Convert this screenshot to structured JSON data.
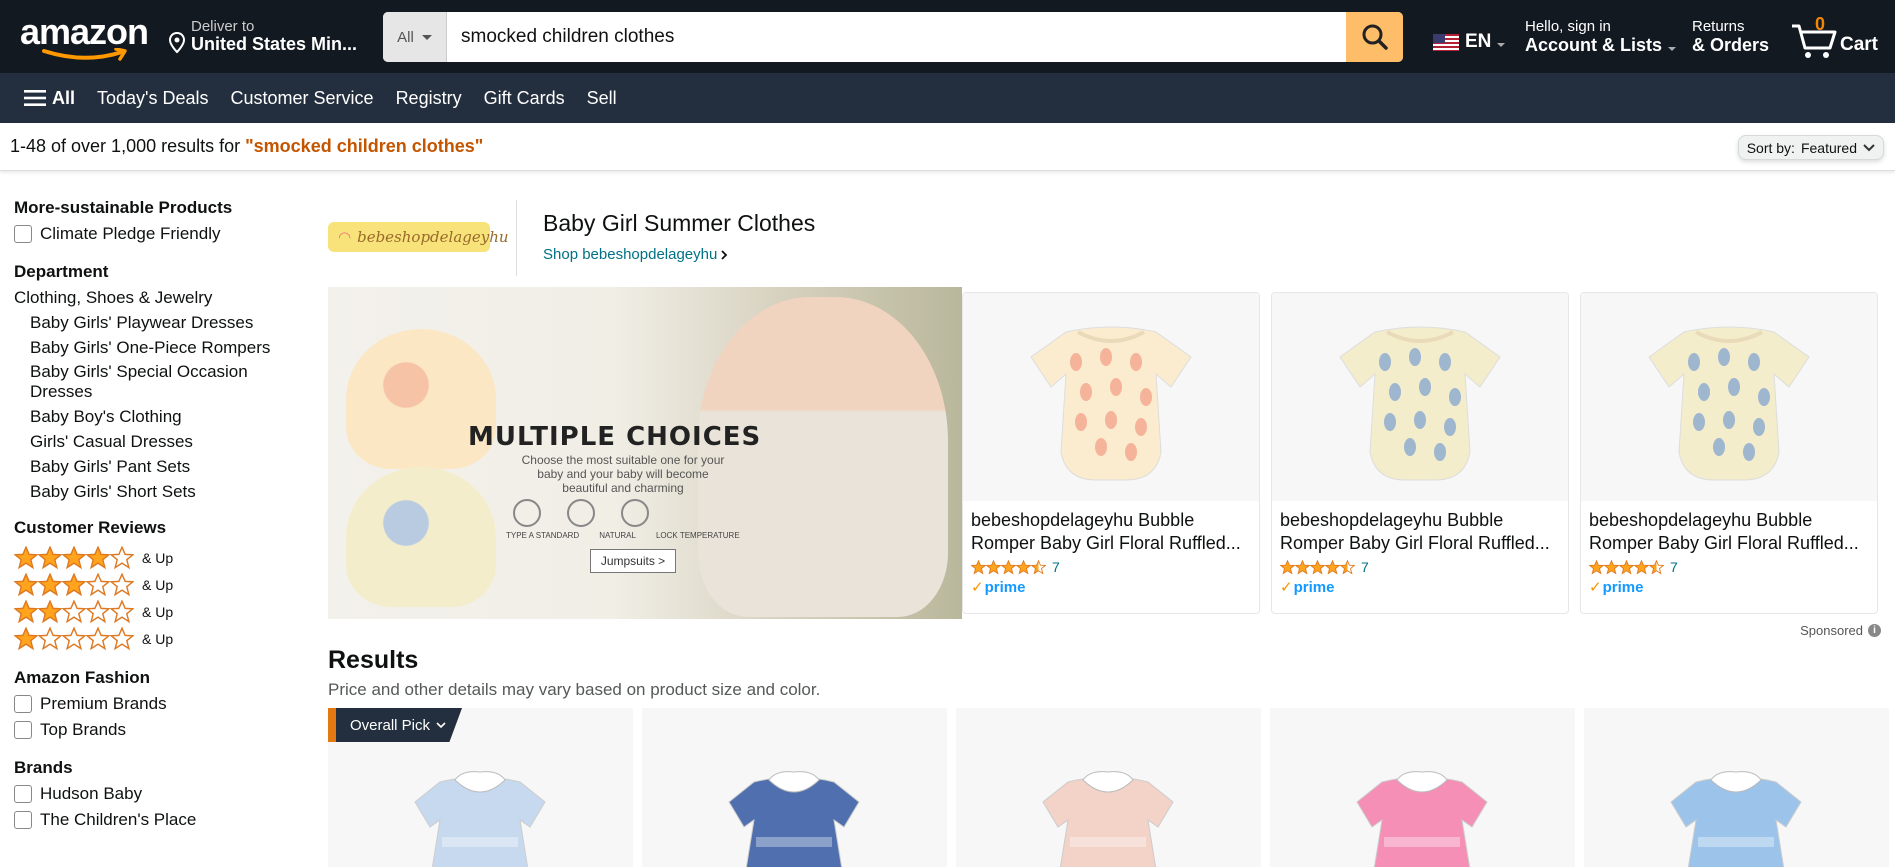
{
  "header": {
    "logo_text": "amazon",
    "deliver_to_label": "Deliver to",
    "deliver_to_location": "United States Min...",
    "search_category": "All",
    "search_query": "smocked children clothes",
    "language": "EN",
    "account_greeting": "Hello, sign in",
    "account_label": "Account & Lists",
    "returns_label": "Returns",
    "orders_label": "& Orders",
    "cart_count": "0",
    "cart_label": "Cart"
  },
  "subnav": {
    "all_label": "All",
    "items": [
      "Today's Deals",
      "Customer Service",
      "Registry",
      "Gift Cards",
      "Sell"
    ]
  },
  "results_bar": {
    "count_text": "1-48 of over 1,000 results for ",
    "query_text": "\"smocked children clothes\"",
    "sort_label": "Sort by:",
    "sort_value": "Featured"
  },
  "sidebar": {
    "sustainable_heading": "More-sustainable Products",
    "sustainable_option": "Climate Pledge Friendly",
    "department_heading": "Department",
    "department_top": "Clothing, Shoes & Jewelry",
    "department_items": [
      "Baby Girls' Playwear Dresses",
      "Baby Girls' One-Piece Rompers",
      "Baby Girls' Special Occasion Dresses",
      "Baby Boy's Clothing",
      "Girls' Casual Dresses",
      "Baby Girls' Pant Sets",
      "Baby Girls' Short Sets"
    ],
    "reviews_heading": "Customer Reviews",
    "review_rows": [
      {
        "stars": 4,
        "label": "& Up"
      },
      {
        "stars": 3,
        "label": "& Up"
      },
      {
        "stars": 2,
        "label": "& Up"
      },
      {
        "stars": 1,
        "label": "& Up"
      }
    ],
    "fashion_heading": "Amazon Fashion",
    "fashion_options": [
      "Premium Brands",
      "Top Brands"
    ],
    "brands_heading": "Brands",
    "brand_options": [
      "Hudson Baby",
      "The Children's Place"
    ]
  },
  "sponsored_brand": {
    "logo_text": "bebeshopdelageyhu",
    "title": "Baby Girl Summer Clothes",
    "shop_link": "Shop bebeshopdelageyhu",
    "banner_headline": "MULTIPLE CHOICES",
    "banner_subtext": "Choose the most suitable one for your baby and your baby will become beautiful and charming",
    "banner_icon_labels": [
      "TYPE A STANDARD",
      "NATURAL",
      "LOCK TEMPERATURE"
    ],
    "banner_button": "Jumpsuits >",
    "products": [
      {
        "title": "bebeshopdelageyhu Bubble Romper Baby Girl Floral Ruffled...",
        "rating": 4.5,
        "review_count": "7",
        "prime": "prime",
        "print_color": "#f5b39a",
        "fabric": "#fbeccf"
      },
      {
        "title": "bebeshopdelageyhu Bubble Romper Baby Girl Floral Ruffled...",
        "rating": 4.5,
        "review_count": "7",
        "prime": "prime",
        "print_color": "#9fb6cf",
        "fabric": "#f3edcb"
      },
      {
        "title": "bebeshopdelageyhu Bubble Romper Baby Girl Floral Ruffled...",
        "rating": 4.5,
        "review_count": "7",
        "prime": "prime",
        "print_color": "#9fb6cf",
        "fabric": "#f3edcb"
      }
    ],
    "sponsored_label": "Sponsored"
  },
  "results": {
    "heading": "Results",
    "subheading": "Price and other details may vary based on product size and color.",
    "badge": "Overall Pick",
    "products": [
      {
        "dress_color": "#c7d9ef"
      },
      {
        "dress_color": "#4f6fae"
      },
      {
        "dress_color": "#f3d2c8"
      },
      {
        "dress_color": "#f58fb6"
      },
      {
        "dress_color": "#9cc3ea"
      }
    ]
  },
  "colors": {
    "nav_dark": "#131921",
    "nav_sub": "#232f3e",
    "search_button": "#febd69",
    "link": "#007185",
    "query_orange": "#c45500",
    "star": "#ffa41c",
    "cart_count": "#f08804"
  }
}
